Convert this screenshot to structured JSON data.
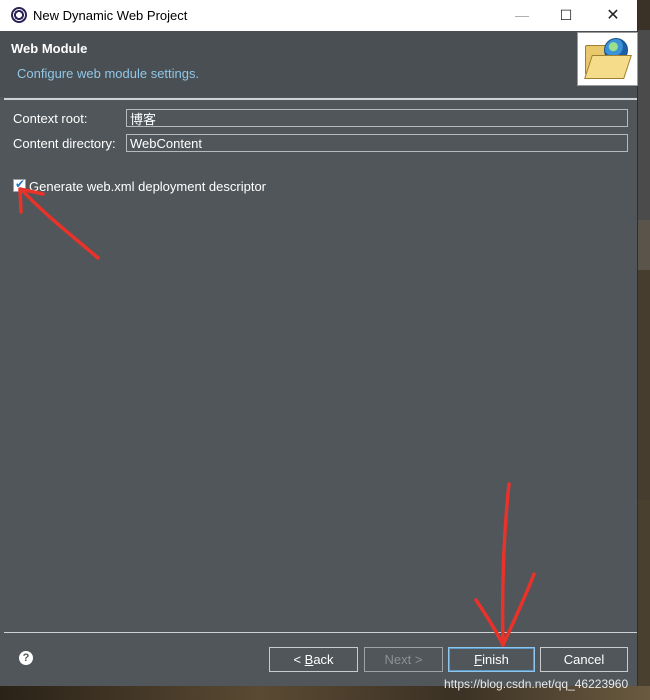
{
  "window": {
    "title": "New Dynamic Web Project",
    "controls": {
      "minimize": "—",
      "maximize": "☐",
      "close": "✕"
    }
  },
  "banner": {
    "title": "Web Module",
    "description": "Configure web module settings.",
    "icon": "folder-globe-icon"
  },
  "form": {
    "context_root": {
      "label": "Context root:",
      "value": "博客"
    },
    "content_directory": {
      "label": "Content directory:",
      "value": "WebContent"
    },
    "generate_web_xml": {
      "label": "Generate web.xml deployment descriptor",
      "checked": true
    }
  },
  "buttons": {
    "help": "?",
    "back_prefix": "< ",
    "back_key": "B",
    "back_rest": "ack",
    "next": "Next >",
    "finish_key": "F",
    "finish_rest": "inish",
    "cancel": "Cancel"
  },
  "annotation_color": "#e8322a",
  "watermark": "https://blog.csdn.net/qq_46223960"
}
